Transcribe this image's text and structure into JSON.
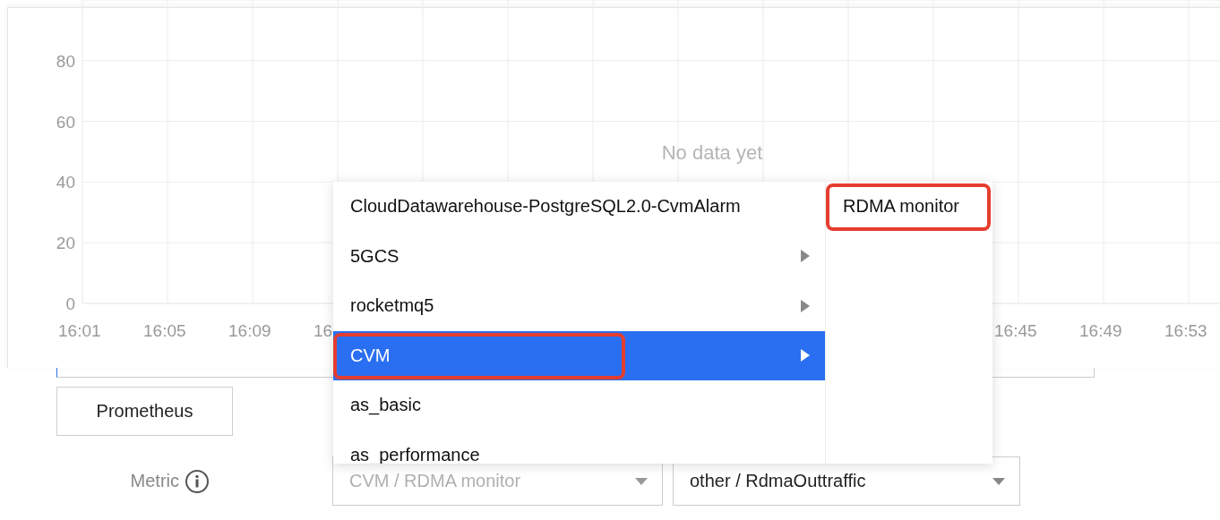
{
  "chart": {
    "empty_message": "No data yet",
    "chart_data": {
      "type": "line",
      "grid": true,
      "ylim": [
        0,
        100
      ],
      "categories": [
        "16:01",
        "16:05",
        "16:09",
        "16",
        null,
        null,
        null,
        null,
        null,
        null,
        null,
        "16:45",
        "16:49",
        "16:53"
      ],
      "yticks": [
        0,
        20,
        40,
        60,
        80
      ]
    }
  },
  "source_button": "Prometheus",
  "metric": {
    "label": "Metric",
    "namespace_select": {
      "value": "CVM / RDMA monitor",
      "disabled": true
    },
    "metric_select": {
      "value": "other / RdmaOuttraffic",
      "disabled": false
    }
  },
  "menu": {
    "items": [
      {
        "label": "CloudDatawarehouse-PostgreSQL2.0-CvmAlarm",
        "has_children": false,
        "selected": false,
        "annotated": false
      },
      {
        "label": "5GCS",
        "has_children": true,
        "selected": false,
        "annotated": false
      },
      {
        "label": "rocketmq5",
        "has_children": true,
        "selected": false,
        "annotated": false
      },
      {
        "label": "CVM",
        "has_children": true,
        "selected": true,
        "annotated": true
      },
      {
        "label": "as_basic",
        "has_children": false,
        "selected": false,
        "annotated": false
      },
      {
        "label": "as_performance",
        "has_children": false,
        "selected": false,
        "annotated": false
      }
    ],
    "submenu": [
      {
        "label": "RDMA monitor",
        "selected": false,
        "annotated": true
      }
    ]
  }
}
